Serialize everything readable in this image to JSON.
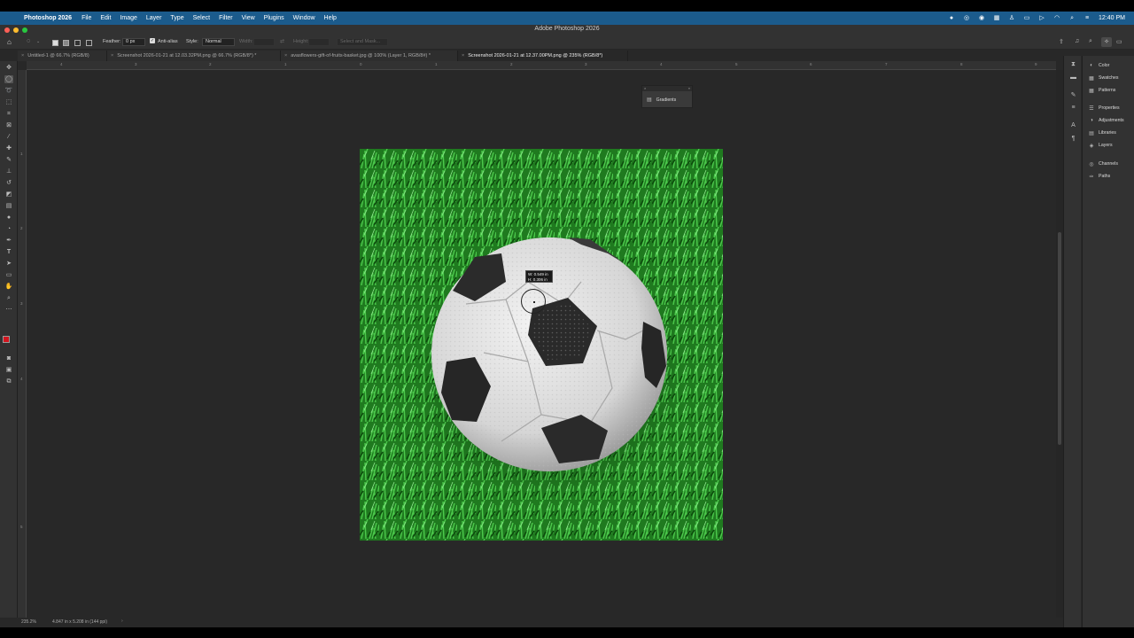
{
  "menubar": {
    "app_name": "Photoshop 2026",
    "items": [
      "File",
      "Edit",
      "Image",
      "Layer",
      "Type",
      "Select",
      "Filter",
      "View",
      "Plugins",
      "Window",
      "Help"
    ],
    "clock": "12:40 PM",
    "accent": "#1b5b8c"
  },
  "titlebar": {
    "title": "Adobe Photoshop 2026"
  },
  "options": {
    "feather_label": "Feather:",
    "feather_value": "0 px",
    "anti_alias_label": "Anti-alias",
    "anti_alias_checked": true,
    "style_label": "Style:",
    "style_value": "Normal",
    "width_label": "Width:",
    "height_label": "Height:",
    "select_mask_label": "Select and Mask..."
  },
  "tabs": [
    {
      "label": "Untitled-1 @ 66.7% (RGB/8)"
    },
    {
      "label": "Screenshot 2026-01-21 at 12.03.32PM.png @ 66.7% (RGB/8*) *"
    },
    {
      "label": "avasflowers-gift-of-fruits-basket.jpg @ 100% (Layer 1, RGB/8#) *"
    },
    {
      "label": "Screenshot 2026-01-21 at 12.37.00PM.png @ 235% (RGB/8*)"
    }
  ],
  "active_tab_index": 3,
  "rulers": {
    "top_labels": [
      "4",
      "3",
      "2",
      "1",
      "0",
      "1",
      "2",
      "3",
      "4",
      "5",
      "6",
      "7",
      "8",
      "9"
    ],
    "left_labels": [
      "1",
      "2",
      "3",
      "4",
      "5"
    ]
  },
  "gradients_panel": {
    "label": "Gradients"
  },
  "right_panels": {
    "group1": [
      "Color",
      "Swatches",
      "Patterns"
    ],
    "group2": [
      "Properties",
      "Adjustments",
      "Libraries",
      "Layers"
    ],
    "group3": [
      "Channels",
      "Paths"
    ]
  },
  "measurement": {
    "w": "W: 0.549 in",
    "h": "H: 0.306 in"
  },
  "status": {
    "zoom": "235.2%",
    "doc_info": "4.847 in x 5.208 in (144 ppi)"
  },
  "colors": {
    "foreground": "#d2141e",
    "background": "#ffffff"
  }
}
